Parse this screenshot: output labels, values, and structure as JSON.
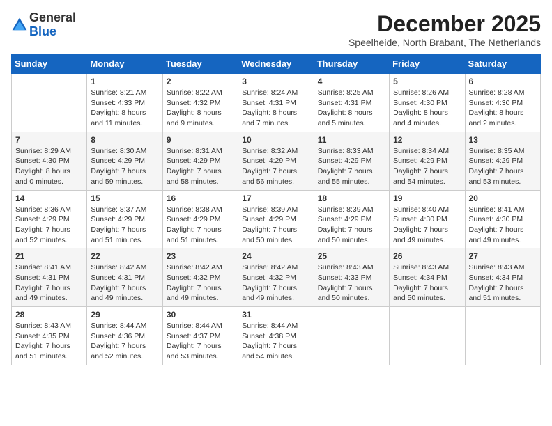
{
  "logo": {
    "general": "General",
    "blue": "Blue"
  },
  "title": {
    "month": "December 2025",
    "location": "Speelheide, North Brabant, The Netherlands"
  },
  "weekdays": [
    "Sunday",
    "Monday",
    "Tuesday",
    "Wednesday",
    "Thursday",
    "Friday",
    "Saturday"
  ],
  "weeks": [
    [
      {
        "day": "",
        "info": ""
      },
      {
        "day": "1",
        "info": "Sunrise: 8:21 AM\nSunset: 4:33 PM\nDaylight: 8 hours\nand 11 minutes."
      },
      {
        "day": "2",
        "info": "Sunrise: 8:22 AM\nSunset: 4:32 PM\nDaylight: 8 hours\nand 9 minutes."
      },
      {
        "day": "3",
        "info": "Sunrise: 8:24 AM\nSunset: 4:31 PM\nDaylight: 8 hours\nand 7 minutes."
      },
      {
        "day": "4",
        "info": "Sunrise: 8:25 AM\nSunset: 4:31 PM\nDaylight: 8 hours\nand 5 minutes."
      },
      {
        "day": "5",
        "info": "Sunrise: 8:26 AM\nSunset: 4:30 PM\nDaylight: 8 hours\nand 4 minutes."
      },
      {
        "day": "6",
        "info": "Sunrise: 8:28 AM\nSunset: 4:30 PM\nDaylight: 8 hours\nand 2 minutes."
      }
    ],
    [
      {
        "day": "7",
        "info": "Sunrise: 8:29 AM\nSunset: 4:30 PM\nDaylight: 8 hours\nand 0 minutes."
      },
      {
        "day": "8",
        "info": "Sunrise: 8:30 AM\nSunset: 4:29 PM\nDaylight: 7 hours\nand 59 minutes."
      },
      {
        "day": "9",
        "info": "Sunrise: 8:31 AM\nSunset: 4:29 PM\nDaylight: 7 hours\nand 58 minutes."
      },
      {
        "day": "10",
        "info": "Sunrise: 8:32 AM\nSunset: 4:29 PM\nDaylight: 7 hours\nand 56 minutes."
      },
      {
        "day": "11",
        "info": "Sunrise: 8:33 AM\nSunset: 4:29 PM\nDaylight: 7 hours\nand 55 minutes."
      },
      {
        "day": "12",
        "info": "Sunrise: 8:34 AM\nSunset: 4:29 PM\nDaylight: 7 hours\nand 54 minutes."
      },
      {
        "day": "13",
        "info": "Sunrise: 8:35 AM\nSunset: 4:29 PM\nDaylight: 7 hours\nand 53 minutes."
      }
    ],
    [
      {
        "day": "14",
        "info": "Sunrise: 8:36 AM\nSunset: 4:29 PM\nDaylight: 7 hours\nand 52 minutes."
      },
      {
        "day": "15",
        "info": "Sunrise: 8:37 AM\nSunset: 4:29 PM\nDaylight: 7 hours\nand 51 minutes."
      },
      {
        "day": "16",
        "info": "Sunrise: 8:38 AM\nSunset: 4:29 PM\nDaylight: 7 hours\nand 51 minutes."
      },
      {
        "day": "17",
        "info": "Sunrise: 8:39 AM\nSunset: 4:29 PM\nDaylight: 7 hours\nand 50 minutes."
      },
      {
        "day": "18",
        "info": "Sunrise: 8:39 AM\nSunset: 4:29 PM\nDaylight: 7 hours\nand 50 minutes."
      },
      {
        "day": "19",
        "info": "Sunrise: 8:40 AM\nSunset: 4:30 PM\nDaylight: 7 hours\nand 49 minutes."
      },
      {
        "day": "20",
        "info": "Sunrise: 8:41 AM\nSunset: 4:30 PM\nDaylight: 7 hours\nand 49 minutes."
      }
    ],
    [
      {
        "day": "21",
        "info": "Sunrise: 8:41 AM\nSunset: 4:31 PM\nDaylight: 7 hours\nand 49 minutes."
      },
      {
        "day": "22",
        "info": "Sunrise: 8:42 AM\nSunset: 4:31 PM\nDaylight: 7 hours\nand 49 minutes."
      },
      {
        "day": "23",
        "info": "Sunrise: 8:42 AM\nSunset: 4:32 PM\nDaylight: 7 hours\nand 49 minutes."
      },
      {
        "day": "24",
        "info": "Sunrise: 8:42 AM\nSunset: 4:32 PM\nDaylight: 7 hours\nand 49 minutes."
      },
      {
        "day": "25",
        "info": "Sunrise: 8:43 AM\nSunset: 4:33 PM\nDaylight: 7 hours\nand 50 minutes."
      },
      {
        "day": "26",
        "info": "Sunrise: 8:43 AM\nSunset: 4:34 PM\nDaylight: 7 hours\nand 50 minutes."
      },
      {
        "day": "27",
        "info": "Sunrise: 8:43 AM\nSunset: 4:34 PM\nDaylight: 7 hours\nand 51 minutes."
      }
    ],
    [
      {
        "day": "28",
        "info": "Sunrise: 8:43 AM\nSunset: 4:35 PM\nDaylight: 7 hours\nand 51 minutes."
      },
      {
        "day": "29",
        "info": "Sunrise: 8:44 AM\nSunset: 4:36 PM\nDaylight: 7 hours\nand 52 minutes."
      },
      {
        "day": "30",
        "info": "Sunrise: 8:44 AM\nSunset: 4:37 PM\nDaylight: 7 hours\nand 53 minutes."
      },
      {
        "day": "31",
        "info": "Sunrise: 8:44 AM\nSunset: 4:38 PM\nDaylight: 7 hours\nand 54 minutes."
      },
      {
        "day": "",
        "info": ""
      },
      {
        "day": "",
        "info": ""
      },
      {
        "day": "",
        "info": ""
      }
    ]
  ]
}
